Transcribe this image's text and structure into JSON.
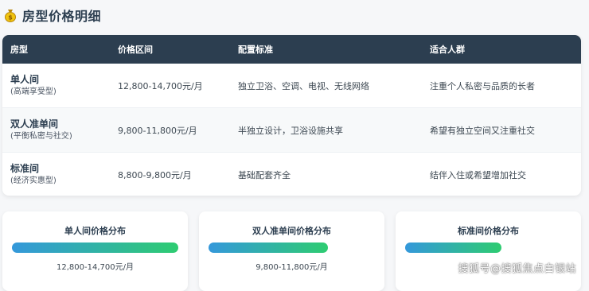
{
  "header": {
    "icon": "money-bag-icon",
    "title": "房型价格明细"
  },
  "table": {
    "headers": [
      "房型",
      "价格区间",
      "配置标准",
      "适合人群"
    ],
    "rows": [
      {
        "type": "单人间",
        "subtype": "(高端享受型)",
        "price": "12,800-14,700元/月",
        "config": "独立卫浴、空调、电视、无线网络",
        "audience": "注重个人私密与品质的长者"
      },
      {
        "type": "双人准单间",
        "subtype": "(平衡私密与社交)",
        "price": "9,800-11,800元/月",
        "config": "半独立设计，卫浴设施共享",
        "audience": "希望有独立空间又注重社交"
      },
      {
        "type": "标准间",
        "subtype": "(经济实惠型)",
        "price": "8,800-9,800元/月",
        "config": "基础配套齐全",
        "audience": "结伴入住或希望增加社交"
      }
    ]
  },
  "cards": [
    {
      "title": "单人间价格分布",
      "price": "12,800-14,700元/月",
      "fill": 1.0
    },
    {
      "title": "双人准单间价格分布",
      "price": "9,800-11,800元/月",
      "fill": 0.72
    },
    {
      "title": "标准间价格分布",
      "price": "",
      "fill": 0.58
    }
  ],
  "watermark": "搜狐号@搜狐焦点白银站",
  "colors": {
    "header_bg": "#2c3e50",
    "bar_start": "#3498db",
    "bar_end": "#2ecc71",
    "page_bg": "#f6f7f9"
  }
}
